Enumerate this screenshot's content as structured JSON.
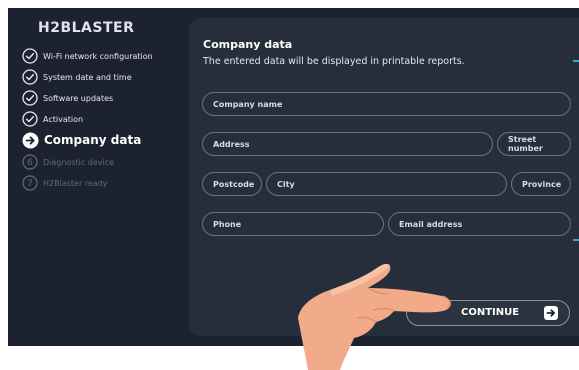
{
  "app": {
    "logo": "H2BLASTER"
  },
  "steps": [
    {
      "label": "Wi-Fi network configuration",
      "state": "done",
      "icon": "check-circle-icon"
    },
    {
      "label": "System date and time",
      "state": "done",
      "icon": "check-circle-icon"
    },
    {
      "label": "Software updates",
      "state": "done",
      "icon": "check-circle-icon"
    },
    {
      "label": "Activation",
      "state": "done",
      "icon": "check-circle-icon"
    },
    {
      "label": "Company data",
      "state": "active",
      "icon": "arrow-circle-icon"
    },
    {
      "label": "Diagnostic device",
      "state": "todo",
      "number": "6"
    },
    {
      "label": "H2Blaster ready",
      "state": "todo",
      "number": "7"
    }
  ],
  "panel": {
    "title": "Company data",
    "subtitle": "The entered data will be displayed in printable reports."
  },
  "form": {
    "company_name": "Company name",
    "address": "Address",
    "street_number": "Street number",
    "postcode": "Postcode",
    "city": "City",
    "province": "Province",
    "phone": "Phone",
    "email": "Email address"
  },
  "actions": {
    "continue_label": "CONTINUE",
    "continue_icon": "arrow-right-icon"
  },
  "colors": {
    "background": "#1c2230",
    "panel": "#272e3b",
    "accent": "#36a6d6",
    "muted": "#626a7b"
  }
}
